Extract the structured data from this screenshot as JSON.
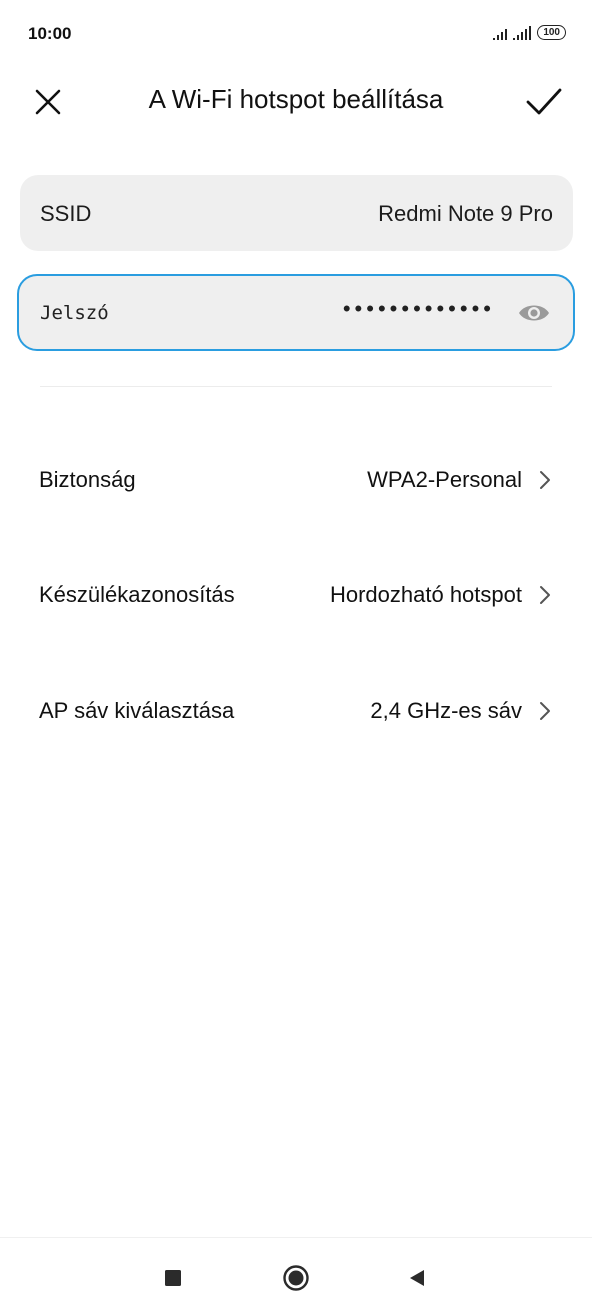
{
  "status_bar": {
    "time": "10:00",
    "battery": "100",
    "icons": [
      "signal-icon",
      "signal-icon",
      "battery-icon"
    ]
  },
  "header": {
    "title": "A Wi-Fi hotspot beállítása",
    "close_icon": "close-icon",
    "confirm_icon": "checkmark-icon"
  },
  "ssid": {
    "label": "SSID",
    "value": "Redmi Note 9 Pro"
  },
  "password": {
    "label": "Jelszó",
    "masked_value": "•••••••••••••",
    "toggle_icon": "eye-icon",
    "focus_color": "#2a9de0"
  },
  "settings": [
    {
      "label": "Biztonság",
      "value": "WPA2-Personal"
    },
    {
      "label": "Készülékazonosítás",
      "value": "Hordozható hotspot"
    },
    {
      "label": "AP sáv kiválasztása",
      "value": "2,4 GHz-es sáv"
    }
  ],
  "nav": {
    "icons": [
      "recents-icon",
      "home-icon",
      "back-icon"
    ]
  }
}
